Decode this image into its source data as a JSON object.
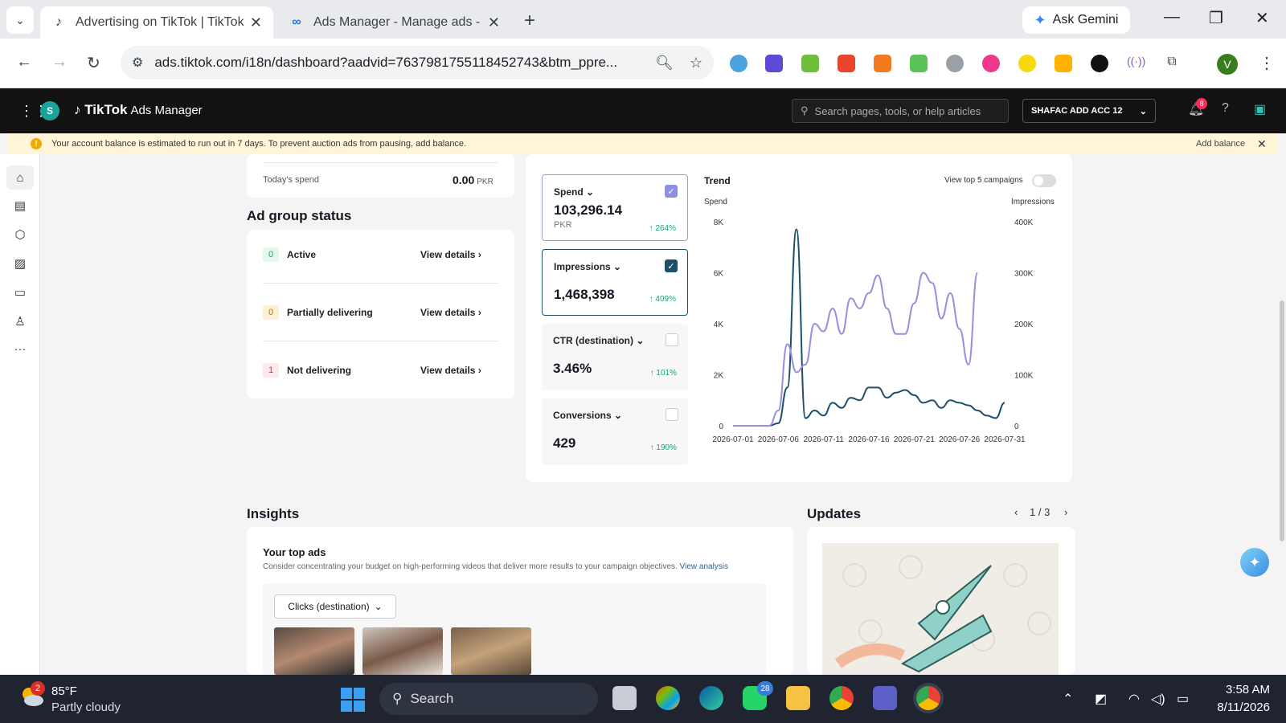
{
  "browser": {
    "tabs": [
      {
        "title": "Advertising on TikTok | TikTok A",
        "active": true
      },
      {
        "title": "Ads Manager - Manage ads - C",
        "active": false
      }
    ],
    "ask_gemini": "Ask Gemini",
    "url": "ads.tiktok.com/i18n/dashboard?aadvid=7637981755118452743&btm_ppre...",
    "profile_initial": "V"
  },
  "header": {
    "brand": "TikTok",
    "brand_sub": "Ads Manager",
    "user_initial": "S",
    "search_placeholder": "Search pages, tools, or help articles",
    "account": "SHAFAC ADD ACC 12",
    "notif_count": "8"
  },
  "alert": {
    "message": "Your account balance is estimated to run out in 7 days. To prevent auction ads from pausing, add balance.",
    "action": "Add balance"
  },
  "today": {
    "label": "Today's spend",
    "value": "0.00",
    "currency": "PKR"
  },
  "ad_group_status": {
    "title": "Ad group status",
    "rows": [
      {
        "count": "0",
        "label": "Active",
        "action": "View details",
        "color": "#e6f7ec",
        "text_color": "#14a86b"
      },
      {
        "count": "0",
        "label": "Partially delivering",
        "action": "View details",
        "color": "#fdf0d5",
        "text_color": "#b37a00"
      },
      {
        "count": "1",
        "label": "Not delivering",
        "action": "View details",
        "color": "#fde8ea",
        "text_color": "#d9364f"
      }
    ]
  },
  "metrics": [
    {
      "label": "Spend",
      "value": "103,296.14",
      "sub": "PKR",
      "delta": "264%",
      "checked": true
    },
    {
      "label": "Impressions",
      "value": "1,468,398",
      "sub": "",
      "delta": "409%",
      "checked": true
    },
    {
      "label": "CTR (destination)",
      "value": "3.46%",
      "sub": "",
      "delta": "101%",
      "checked": false
    },
    {
      "label": "Conversions",
      "value": "429",
      "sub": "",
      "delta": "190%",
      "checked": false
    }
  ],
  "trend": {
    "title": "Trend",
    "top5_label": "View top 5 campaigns",
    "left_axis": "Spend",
    "right_axis": "Impressions"
  },
  "chart_data": {
    "type": "line",
    "x": [
      "2026-07-01",
      "2026-07-02",
      "2026-07-03",
      "2026-07-04",
      "2026-07-05",
      "2026-07-06",
      "2026-07-07",
      "2026-07-08",
      "2026-07-09",
      "2026-07-10",
      "2026-07-11",
      "2026-07-12",
      "2026-07-13",
      "2026-07-14",
      "2026-07-15",
      "2026-07-16",
      "2026-07-17",
      "2026-07-18",
      "2026-07-19",
      "2026-07-20",
      "2026-07-21",
      "2026-07-22",
      "2026-07-23",
      "2026-07-24",
      "2026-07-25",
      "2026-07-26",
      "2026-07-27",
      "2026-07-28",
      "2026-07-29",
      "2026-07-30",
      "2026-07-31"
    ],
    "x_ticks": [
      "2026-07-01",
      "2026-07-06",
      "2026-07-11",
      "2026-07-16",
      "2026-07-21",
      "2026-07-26",
      "2026-07-31"
    ],
    "series": [
      {
        "name": "Spend",
        "axis": "left",
        "color": "#1d4f6c",
        "values": [
          0,
          0,
          0,
          0,
          0,
          100,
          1500,
          7700,
          300,
          600,
          400,
          900,
          700,
          1100,
          1000,
          1500,
          1500,
          1100,
          1300,
          1400,
          1200,
          900,
          1000,
          700,
          1000,
          900,
          800,
          600,
          400,
          300,
          900
        ]
      },
      {
        "name": "Impressions",
        "axis": "right",
        "color": "#9a8de0",
        "values": [
          0,
          0,
          0,
          0,
          0,
          30000,
          160000,
          105000,
          120000,
          200000,
          185000,
          230000,
          180000,
          250000,
          230000,
          260000,
          295000,
          230000,
          180000,
          180000,
          240000,
          300000,
          280000,
          210000,
          260000,
          190000,
          120000,
          300000
        ]
      }
    ],
    "left_ticks": [
      "0",
      "2K",
      "4K",
      "6K",
      "8K"
    ],
    "left_ylim": [
      0,
      8000
    ],
    "right_ticks": [
      "0",
      "100K",
      "200K",
      "300K",
      "400K"
    ],
    "right_ylim": [
      0,
      400000
    ]
  },
  "insights": {
    "title": "Insights",
    "top_ads_title": "Your top ads",
    "top_ads_desc": "Consider concentrating your budget on high-performing videos that deliver more results to your campaign objectives.",
    "view_analysis": "View analysis",
    "dropdown": "Clicks (destination)"
  },
  "updates": {
    "title": "Updates",
    "page": "1 / 3"
  },
  "taskbar": {
    "weather_badge": "2",
    "temp": "85°F",
    "condition": "Partly cloudy",
    "search": "Search",
    "whatsapp_badge": "28",
    "time": "3:58 AM",
    "date": "8/11/2026"
  }
}
